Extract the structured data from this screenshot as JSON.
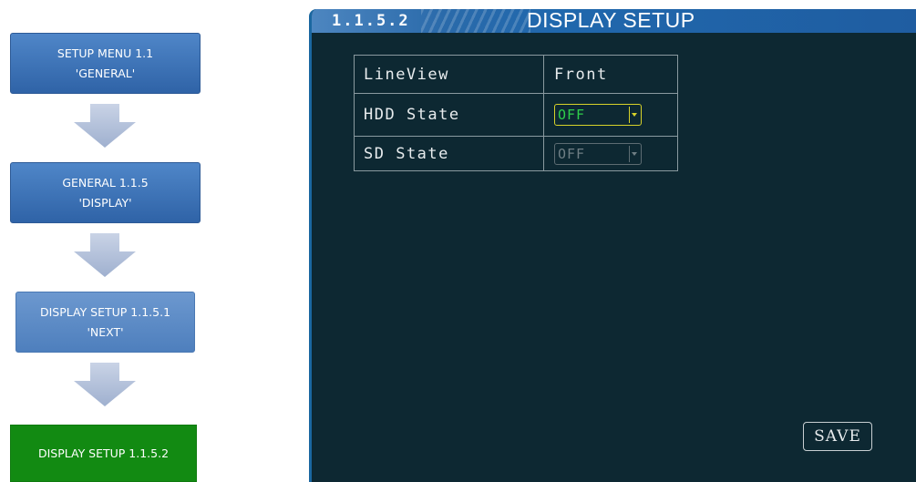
{
  "flow": {
    "steps": [
      {
        "title": "SETUP MENU 1.1",
        "sub": "'GENERAL'",
        "color": "#2f63a7"
      },
      {
        "title": "GENERAL 1.1.5",
        "sub": "'DISPLAY'",
        "color": "#2f63a7"
      },
      {
        "title": "DISPLAY SETUP 1.1.5.1",
        "sub": "'NEXT'",
        "color": "#4e7fbd"
      },
      {
        "title": "DISPLAY SETUP 1.1.5.2",
        "sub": "",
        "color": "#128a12"
      }
    ]
  },
  "screen": {
    "menu_number": "1.1.5.2",
    "title": "DISPLAY SETUP",
    "rows": [
      {
        "label": "LineView",
        "value": "Front"
      },
      {
        "label": "HDD State",
        "value": "OFF"
      },
      {
        "label": "SD State",
        "value": "OFF"
      }
    ],
    "save_label": "SAVE"
  },
  "colors": {
    "screen_bg": "#0d2832",
    "title_bar": "#2068ad",
    "active_select_border": "#d7d22a",
    "active_select_text": "#2fd04a"
  }
}
